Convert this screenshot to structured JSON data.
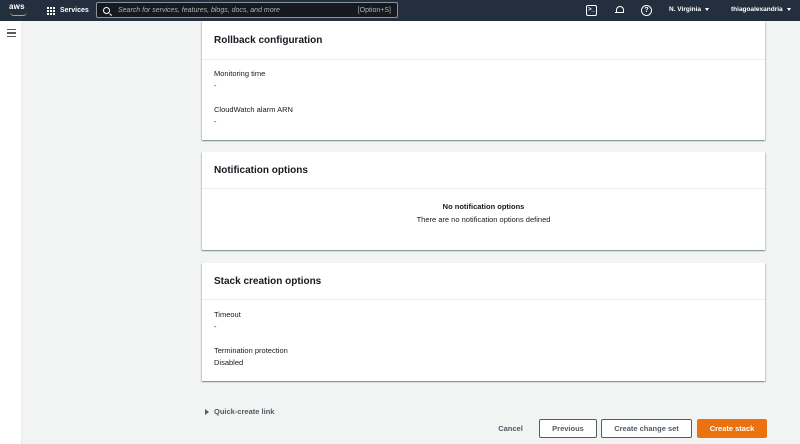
{
  "topnav": {
    "logo_text": "aws",
    "services_label": "Services",
    "search_placeholder": "Search for services, features, blogs, docs, and more",
    "search_shortcut": "[Option+S]",
    "cloudshell_glyph": ">_",
    "help_glyph": "?",
    "region": "N. Virginia",
    "user": "thiagoalexandria"
  },
  "rollback": {
    "title": "Rollback configuration",
    "monitoring_time_label": "Monitoring time",
    "monitoring_time_value": "-",
    "alarm_arn_label": "CloudWatch alarm ARN",
    "alarm_arn_value": "-"
  },
  "notifications": {
    "title": "Notification options",
    "empty_title": "No notification options",
    "empty_desc": "There are no notification options defined"
  },
  "stack_creation": {
    "title": "Stack creation options",
    "timeout_label": "Timeout",
    "timeout_value": "-",
    "termination_label": "Termination protection",
    "termination_value": "Disabled"
  },
  "quick_create": "Quick-create link",
  "footer": {
    "cancel": "Cancel",
    "previous": "Previous",
    "create_change_set": "Create change set",
    "create_stack": "Create stack"
  },
  "colors": {
    "nav_bg": "#232f3e",
    "primary_button": "#ec7211",
    "logo_smile": "#ff9900"
  }
}
